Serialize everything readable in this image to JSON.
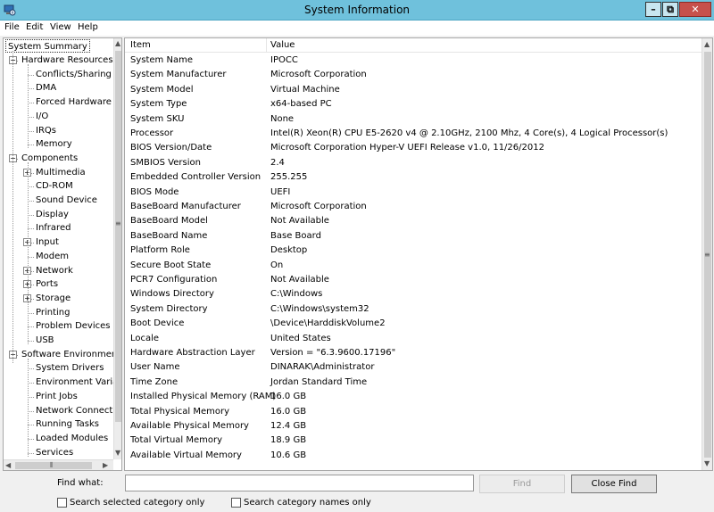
{
  "window": {
    "title": "System Information"
  },
  "menu": [
    "File",
    "Edit",
    "View",
    "Help"
  ],
  "tree": {
    "root": "System Summary",
    "nodes": [
      {
        "label": "Hardware Resources",
        "level": 1,
        "expander": "minus"
      },
      {
        "label": "Conflicts/Sharing",
        "level": 2
      },
      {
        "label": "DMA",
        "level": 2
      },
      {
        "label": "Forced Hardware",
        "level": 2
      },
      {
        "label": "I/O",
        "level": 2
      },
      {
        "label": "IRQs",
        "level": 2
      },
      {
        "label": "Memory",
        "level": 2
      },
      {
        "label": "Components",
        "level": 1,
        "expander": "minus"
      },
      {
        "label": "Multimedia",
        "level": 2,
        "expander": "plus"
      },
      {
        "label": "CD-ROM",
        "level": 2
      },
      {
        "label": "Sound Device",
        "level": 2
      },
      {
        "label": "Display",
        "level": 2
      },
      {
        "label": "Infrared",
        "level": 2
      },
      {
        "label": "Input",
        "level": 2,
        "expander": "plus"
      },
      {
        "label": "Modem",
        "level": 2
      },
      {
        "label": "Network",
        "level": 2,
        "expander": "plus"
      },
      {
        "label": "Ports",
        "level": 2,
        "expander": "plus"
      },
      {
        "label": "Storage",
        "level": 2,
        "expander": "plus"
      },
      {
        "label": "Printing",
        "level": 2
      },
      {
        "label": "Problem Devices",
        "level": 2
      },
      {
        "label": "USB",
        "level": 2
      },
      {
        "label": "Software Environment",
        "level": 1,
        "expander": "minus"
      },
      {
        "label": "System Drivers",
        "level": 2
      },
      {
        "label": "Environment Variables",
        "level": 2
      },
      {
        "label": "Print Jobs",
        "level": 2
      },
      {
        "label": "Network Connections",
        "level": 2
      },
      {
        "label": "Running Tasks",
        "level": 2
      },
      {
        "label": "Loaded Modules",
        "level": 2
      },
      {
        "label": "Services",
        "level": 2
      }
    ]
  },
  "list": {
    "columns": [
      "Item",
      "Value"
    ],
    "rows": [
      [
        "System Name",
        "IPOCC"
      ],
      [
        "System Manufacturer",
        "Microsoft Corporation"
      ],
      [
        "System Model",
        "Virtual Machine"
      ],
      [
        "System Type",
        "x64-based PC"
      ],
      [
        "System SKU",
        "None"
      ],
      [
        "Processor",
        "Intel(R) Xeon(R) CPU E5-2620 v4 @ 2.10GHz, 2100 Mhz, 4 Core(s), 4 Logical Processor(s)"
      ],
      [
        "BIOS Version/Date",
        "Microsoft Corporation Hyper-V UEFI Release v1.0, 11/26/2012"
      ],
      [
        "SMBIOS Version",
        "2.4"
      ],
      [
        "Embedded Controller Version",
        "255.255"
      ],
      [
        "BIOS Mode",
        "UEFI"
      ],
      [
        "BaseBoard Manufacturer",
        "Microsoft Corporation"
      ],
      [
        "BaseBoard Model",
        "Not Available"
      ],
      [
        "BaseBoard Name",
        "Base Board"
      ],
      [
        "Platform Role",
        "Desktop"
      ],
      [
        "Secure Boot State",
        "On"
      ],
      [
        "PCR7 Configuration",
        "Not Available"
      ],
      [
        "Windows Directory",
        "C:\\Windows"
      ],
      [
        "System Directory",
        "C:\\Windows\\system32"
      ],
      [
        "Boot Device",
        "\\Device\\HarddiskVolume2"
      ],
      [
        "Locale",
        "United States"
      ],
      [
        "Hardware Abstraction Layer",
        "Version = \"6.3.9600.17196\""
      ],
      [
        "User Name",
        "DINARAK\\Administrator"
      ],
      [
        "Time Zone",
        "Jordan Standard Time"
      ],
      [
        "Installed Physical Memory (RAM)",
        "16.0 GB"
      ],
      [
        "Total Physical Memory",
        "16.0 GB"
      ],
      [
        "Available Physical Memory",
        "12.4 GB"
      ],
      [
        "Total Virtual Memory",
        "18.9 GB"
      ],
      [
        "Available Virtual Memory",
        "10.6 GB"
      ]
    ]
  },
  "find": {
    "label": "Find what:",
    "value": "",
    "find_button": "Find",
    "close_button": "Close Find",
    "check_selected": "Search selected category only",
    "check_names": "Search category names only"
  }
}
